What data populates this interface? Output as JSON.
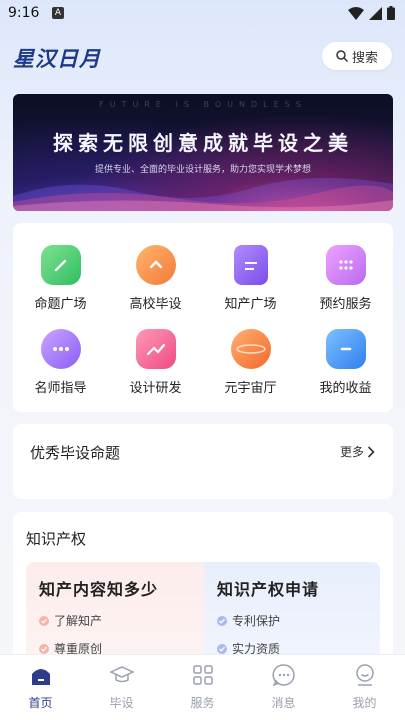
{
  "status_bar": {
    "time": "9:16",
    "notification_badge": "A"
  },
  "header": {
    "logo": "星汉日月",
    "search_label": "搜索"
  },
  "banner": {
    "tagline_en": "FUTURE IS BOUNDLESS",
    "title": "探索无限创意成就毕设之美",
    "subtitle": "提供专业、全面的毕业设计服务，助力您实现学术梦想"
  },
  "services": [
    {
      "label": "命题广场",
      "icon": "pencil-icon",
      "color": "#3fc46a"
    },
    {
      "label": "高校毕设",
      "icon": "badge-icon",
      "color": "#f58a3a"
    },
    {
      "label": "知产广场",
      "icon": "document-icon",
      "color": "#8a5cf0"
    },
    {
      "label": "预约服务",
      "icon": "calendar-icon",
      "color": "#c86cf0"
    },
    {
      "label": "名师指导",
      "icon": "chat-icon",
      "color": "#9b6cf5"
    },
    {
      "label": "设计研发",
      "icon": "chart-icon",
      "color": "#f0508a"
    },
    {
      "label": "元宇宙厅",
      "icon": "planet-icon",
      "color": "#f5793a"
    },
    {
      "label": "我的收益",
      "icon": "wallet-icon",
      "color": "#3a8ef5"
    }
  ],
  "featured": {
    "title": "优秀毕设命题",
    "more_label": "更多"
  },
  "ip": {
    "title": "知识产权",
    "left": {
      "heading": "知产内容知多少",
      "items": [
        "了解知产",
        "尊重原创"
      ]
    },
    "right": {
      "heading": "知识产权申请",
      "items": [
        "专利保护",
        "实力资质"
      ]
    }
  },
  "tabs": [
    {
      "label": "首页",
      "icon": "home-icon",
      "active": true
    },
    {
      "label": "毕设",
      "icon": "graduation-cap-icon",
      "active": false
    },
    {
      "label": "服务",
      "icon": "grid-icon",
      "active": false
    },
    {
      "label": "消息",
      "icon": "message-icon",
      "active": false
    },
    {
      "label": "我的",
      "icon": "profile-icon",
      "active": false
    }
  ],
  "colors": {
    "brand": "#1d3a8a",
    "tab_active": "#2d3d8a",
    "tab_inactive": "#9aa0ad"
  }
}
